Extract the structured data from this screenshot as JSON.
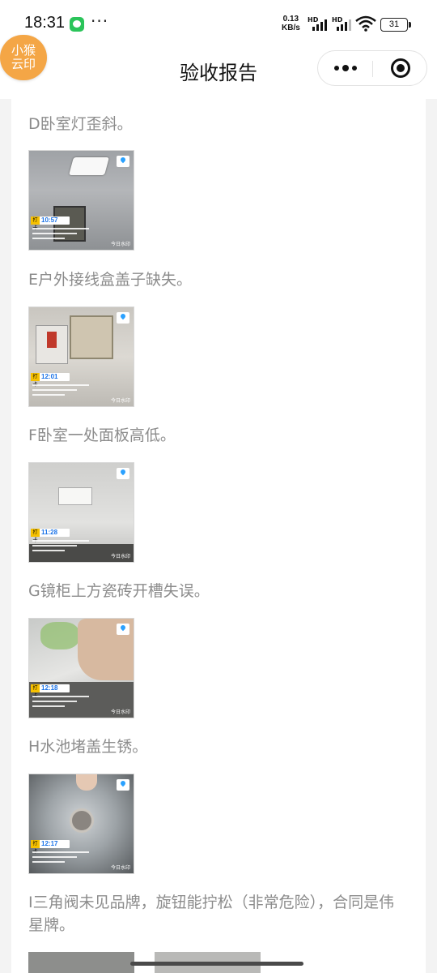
{
  "status_bar": {
    "time": "18:31",
    "speed_value": "0.13",
    "speed_unit": "KB/s",
    "hd_1": "HD",
    "hd_2": "HD",
    "battery": "31"
  },
  "header": {
    "logo_line1": "小猴",
    "logo_line2": "云印",
    "title": "验收报告"
  },
  "items": [
    {
      "text": "D卧室灯歪斜。",
      "time": "10:57"
    },
    {
      "text": "E户外接线盒盖子缺失。",
      "time": "12:01"
    },
    {
      "text": "F卧室一处面板高低。",
      "time": "11:28"
    },
    {
      "text": "G镜柜上方瓷砖开槽失误。",
      "time": "12:18"
    },
    {
      "text": "H水池堵盖生锈。",
      "time": "12:17"
    },
    {
      "text": "I三角阀未见品牌，旋钮能拧松（非常危险），合同是伟星牌。"
    }
  ],
  "photo_tag": "打卡",
  "photo_brand": "今日水印",
  "colors": {
    "background": "#f3f3f3",
    "text_gray": "#8c8c8c",
    "logo_orange": "#f4a646",
    "time_blue": "#1a73e8",
    "tag_yellow": "#f6c000"
  }
}
